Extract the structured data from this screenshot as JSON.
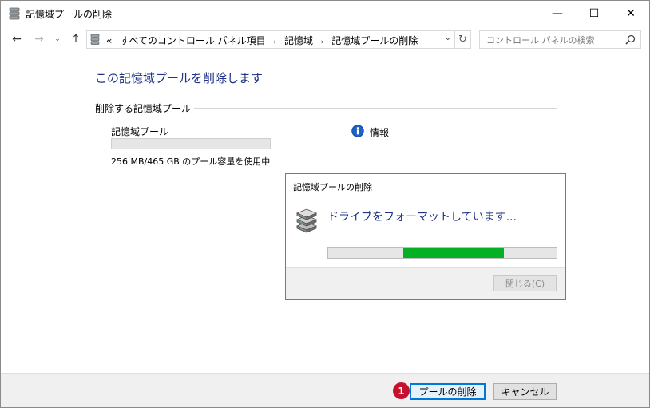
{
  "window": {
    "title": "記憶域プールの削除",
    "controls": {
      "minimize": "—",
      "maximize": "☐",
      "close": "✕"
    }
  },
  "nav": {
    "back": "←",
    "forward": "→",
    "recent": "⌄",
    "up": "↑",
    "breadcrumb": [
      "«",
      "すべてのコントロール パネル項目",
      "記憶域",
      "記憶域プールの削除"
    ],
    "separator": "›",
    "refresh": "↻",
    "dropdown": "⌄",
    "search_placeholder": "コントロール パネルの検索"
  },
  "content": {
    "heading": "この記憶域プールを削除します",
    "group_label": "削除する記憶域プール",
    "pool_label": "記憶域プール",
    "usage": "256 MB/465 GB のプール容量を使用中",
    "info_label": "情報"
  },
  "dialog": {
    "title": "記憶域プールの削除",
    "message": "ドライブをフォーマットしています...",
    "progress": {
      "start_fraction": 0.33,
      "end_fraction": 0.77
    },
    "close_button": "閉じる(C)"
  },
  "footer": {
    "badge": "1",
    "delete_button": "プールの削除",
    "cancel_button": "キャンセル"
  },
  "colors": {
    "heading": "#1e3287",
    "progress_fill": "#06b025",
    "badge": "#c8102e",
    "focus_border": "#0078d7"
  },
  "icons": {
    "title": "storage-pool-icon",
    "info": "info-icon",
    "dialog": "drive-stack-icon",
    "search": "search-icon"
  }
}
